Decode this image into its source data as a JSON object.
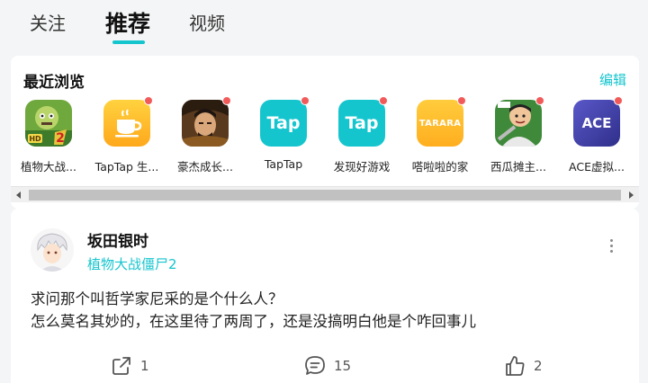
{
  "tabs": [
    {
      "label": "关注"
    },
    {
      "label": "推荐"
    },
    {
      "label": "视频"
    }
  ],
  "recent": {
    "title": "最近浏览",
    "edit_label": "编辑",
    "apps": [
      {
        "label": "植物大战...",
        "icon": "pvz2-icon",
        "has_dot": false,
        "icon_text": ""
      },
      {
        "label": "TapTap 生...",
        "icon": "coffee-cup-icon",
        "has_dot": true,
        "icon_text": ""
      },
      {
        "label": "豪杰成长...",
        "icon": "warrior-portrait-icon",
        "has_dot": true,
        "icon_text": ""
      },
      {
        "label": "TapTap",
        "icon": "taptap-icon",
        "has_dot": true,
        "icon_text": "Tap"
      },
      {
        "label": "发现好游戏",
        "icon": "taptap-icon",
        "has_dot": true,
        "icon_text": "Tap"
      },
      {
        "label": "嗒啦啦的家",
        "icon": "tarara-icon",
        "has_dot": true,
        "icon_text": "TARARA"
      },
      {
        "label": "西瓜摊主...",
        "icon": "watermelon-vendor-icon",
        "has_dot": true,
        "icon_text": ""
      },
      {
        "label": "ACE虚拟...",
        "icon": "ace-icon",
        "has_dot": true,
        "icon_text": "ACE"
      }
    ]
  },
  "post": {
    "author": "坂田银时",
    "game": "植物大战僵尸2",
    "text_lines": [
      "求问那个叫哲学家尼采的是个什么人？",
      "怎么莫名其妙的，在这里待了两周了，还是没搞明白他是个咋回事儿"
    ],
    "actions": {
      "share_count": "1",
      "comment_count": "15",
      "like_count": "2"
    }
  },
  "colors": {
    "accent": "#15c5ce",
    "badge": "#f25a5a",
    "background": "#f4f5f6"
  }
}
